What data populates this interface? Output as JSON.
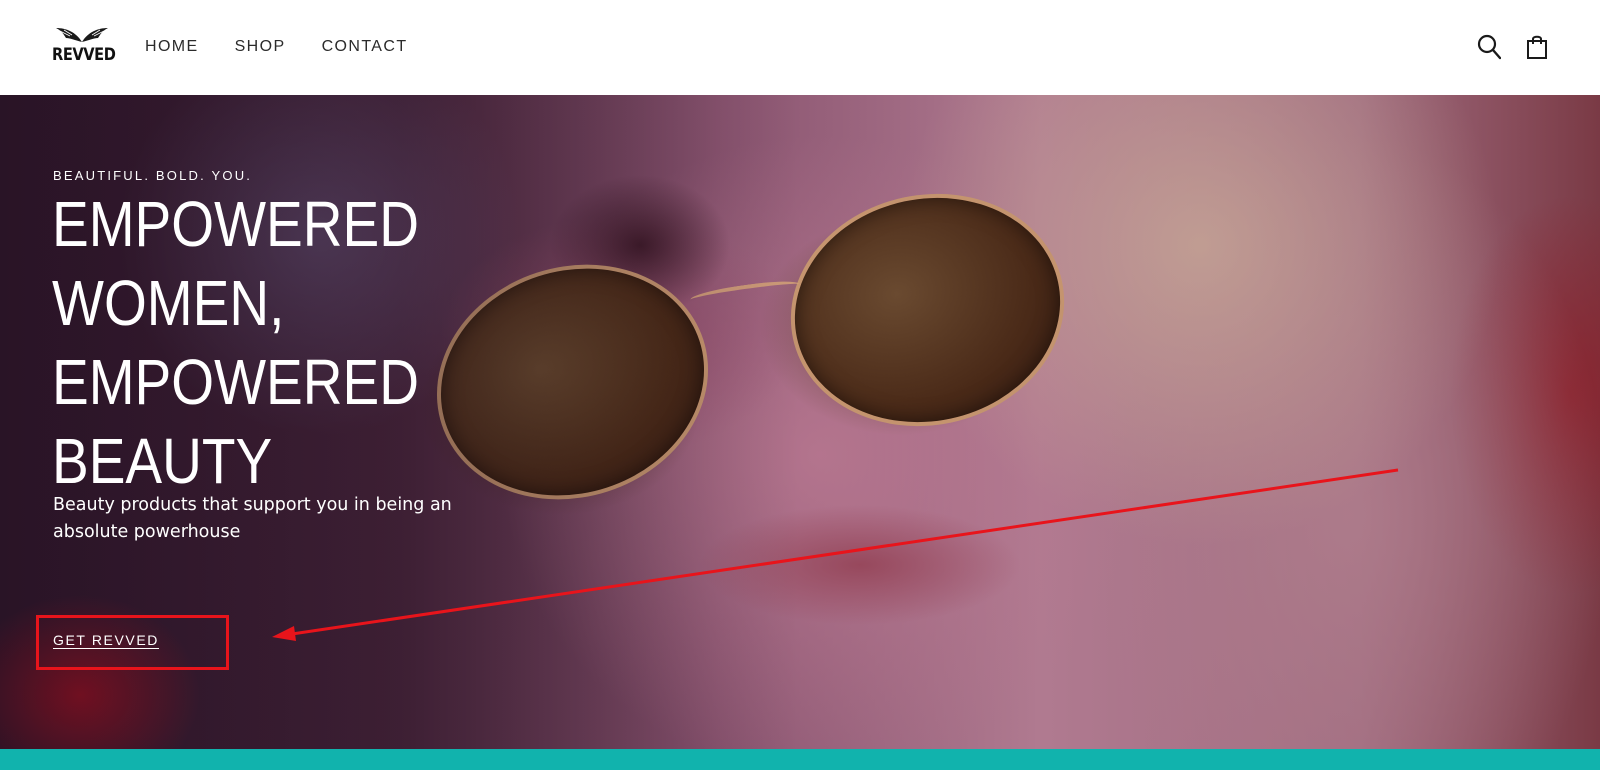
{
  "header": {
    "logo_text": "REVVED",
    "nav": [
      {
        "label": "HOME"
      },
      {
        "label": "SHOP"
      },
      {
        "label": "CONTACT"
      }
    ],
    "icons": {
      "search": "search-icon",
      "cart": "shopping-bag-icon"
    }
  },
  "hero": {
    "eyebrow": "BEAUTIFUL. BOLD. YOU.",
    "headline_lines": [
      "EMPOWERED",
      "WOMEN,",
      "EMPOWERED",
      "BEAUTY"
    ],
    "subtext": "Beauty products that support you in being an absolute powerhouse",
    "cta_label": "GET REVVED"
  },
  "annotation": {
    "color": "#e8141b"
  },
  "colors": {
    "footer_band": "#11b3ad",
    "text_dark": "#2b2b2b"
  }
}
